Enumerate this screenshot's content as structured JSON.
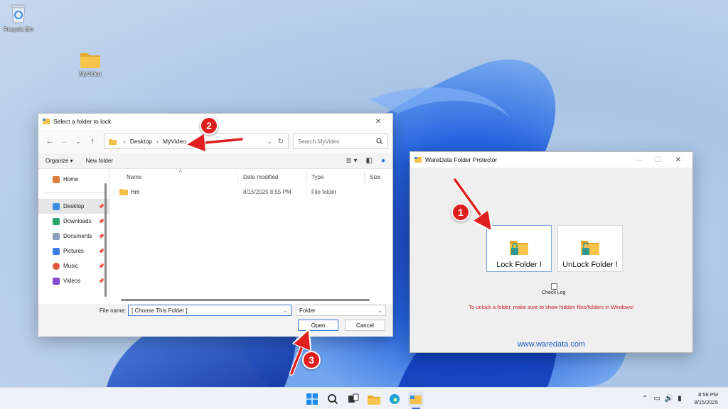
{
  "desktop": {
    "icons": [
      {
        "label": "Recycle Bin",
        "icon": "recycle-bin-icon"
      },
      {
        "label": "MyVideo",
        "icon": "folder-icon"
      }
    ]
  },
  "dialog": {
    "title": "Select a folder to lock",
    "address": [
      "Desktop",
      "MyVideo"
    ],
    "search_placeholder": "Search MyVideo",
    "toolbar": {
      "organize": "Organize ▾",
      "new_folder": "New folder"
    },
    "sidebar": [
      {
        "label": "Home",
        "icon": "home-icon"
      },
      {
        "label": "Desktop",
        "icon": "desktop-icon"
      },
      {
        "label": "Downloads",
        "icon": "downloads-icon"
      },
      {
        "label": "Documents",
        "icon": "documents-icon"
      },
      {
        "label": "Pictures",
        "icon": "pictures-icon"
      },
      {
        "label": "Music",
        "icon": "music-icon"
      },
      {
        "label": "Videos",
        "icon": "videos-icon"
      }
    ],
    "columns": [
      "Name",
      "Date modified",
      "Type",
      "Size"
    ],
    "files": [
      {
        "name": "Hm",
        "date": "8/15/2025 8:55 PM",
        "type": "File folder"
      }
    ],
    "file_name_label": "File name:",
    "file_name_value": "[ Choose This Folder ]",
    "file_type": "Folder",
    "open_label": "Open",
    "cancel_label": "Cancel"
  },
  "protector": {
    "title": "WareData Folder Protector",
    "lock_label": "Lock Folder !",
    "unlock_label": "UnLock Folder !",
    "check_log_label": "Check Log",
    "warning": "To unlock a folder, make sure to show hidden files/folders in Windows!",
    "site": "www.waredata.com"
  },
  "badges": [
    "1",
    "2",
    "3"
  ],
  "taskbar": {
    "time": "8:58 PM",
    "date": "8/15/2025"
  },
  "colors": {
    "accent_blue": "#1e5fc9",
    "warning_red": "#c81d25",
    "badge_red": "#e01e1e",
    "folder_yellow": "#f5c04a"
  }
}
